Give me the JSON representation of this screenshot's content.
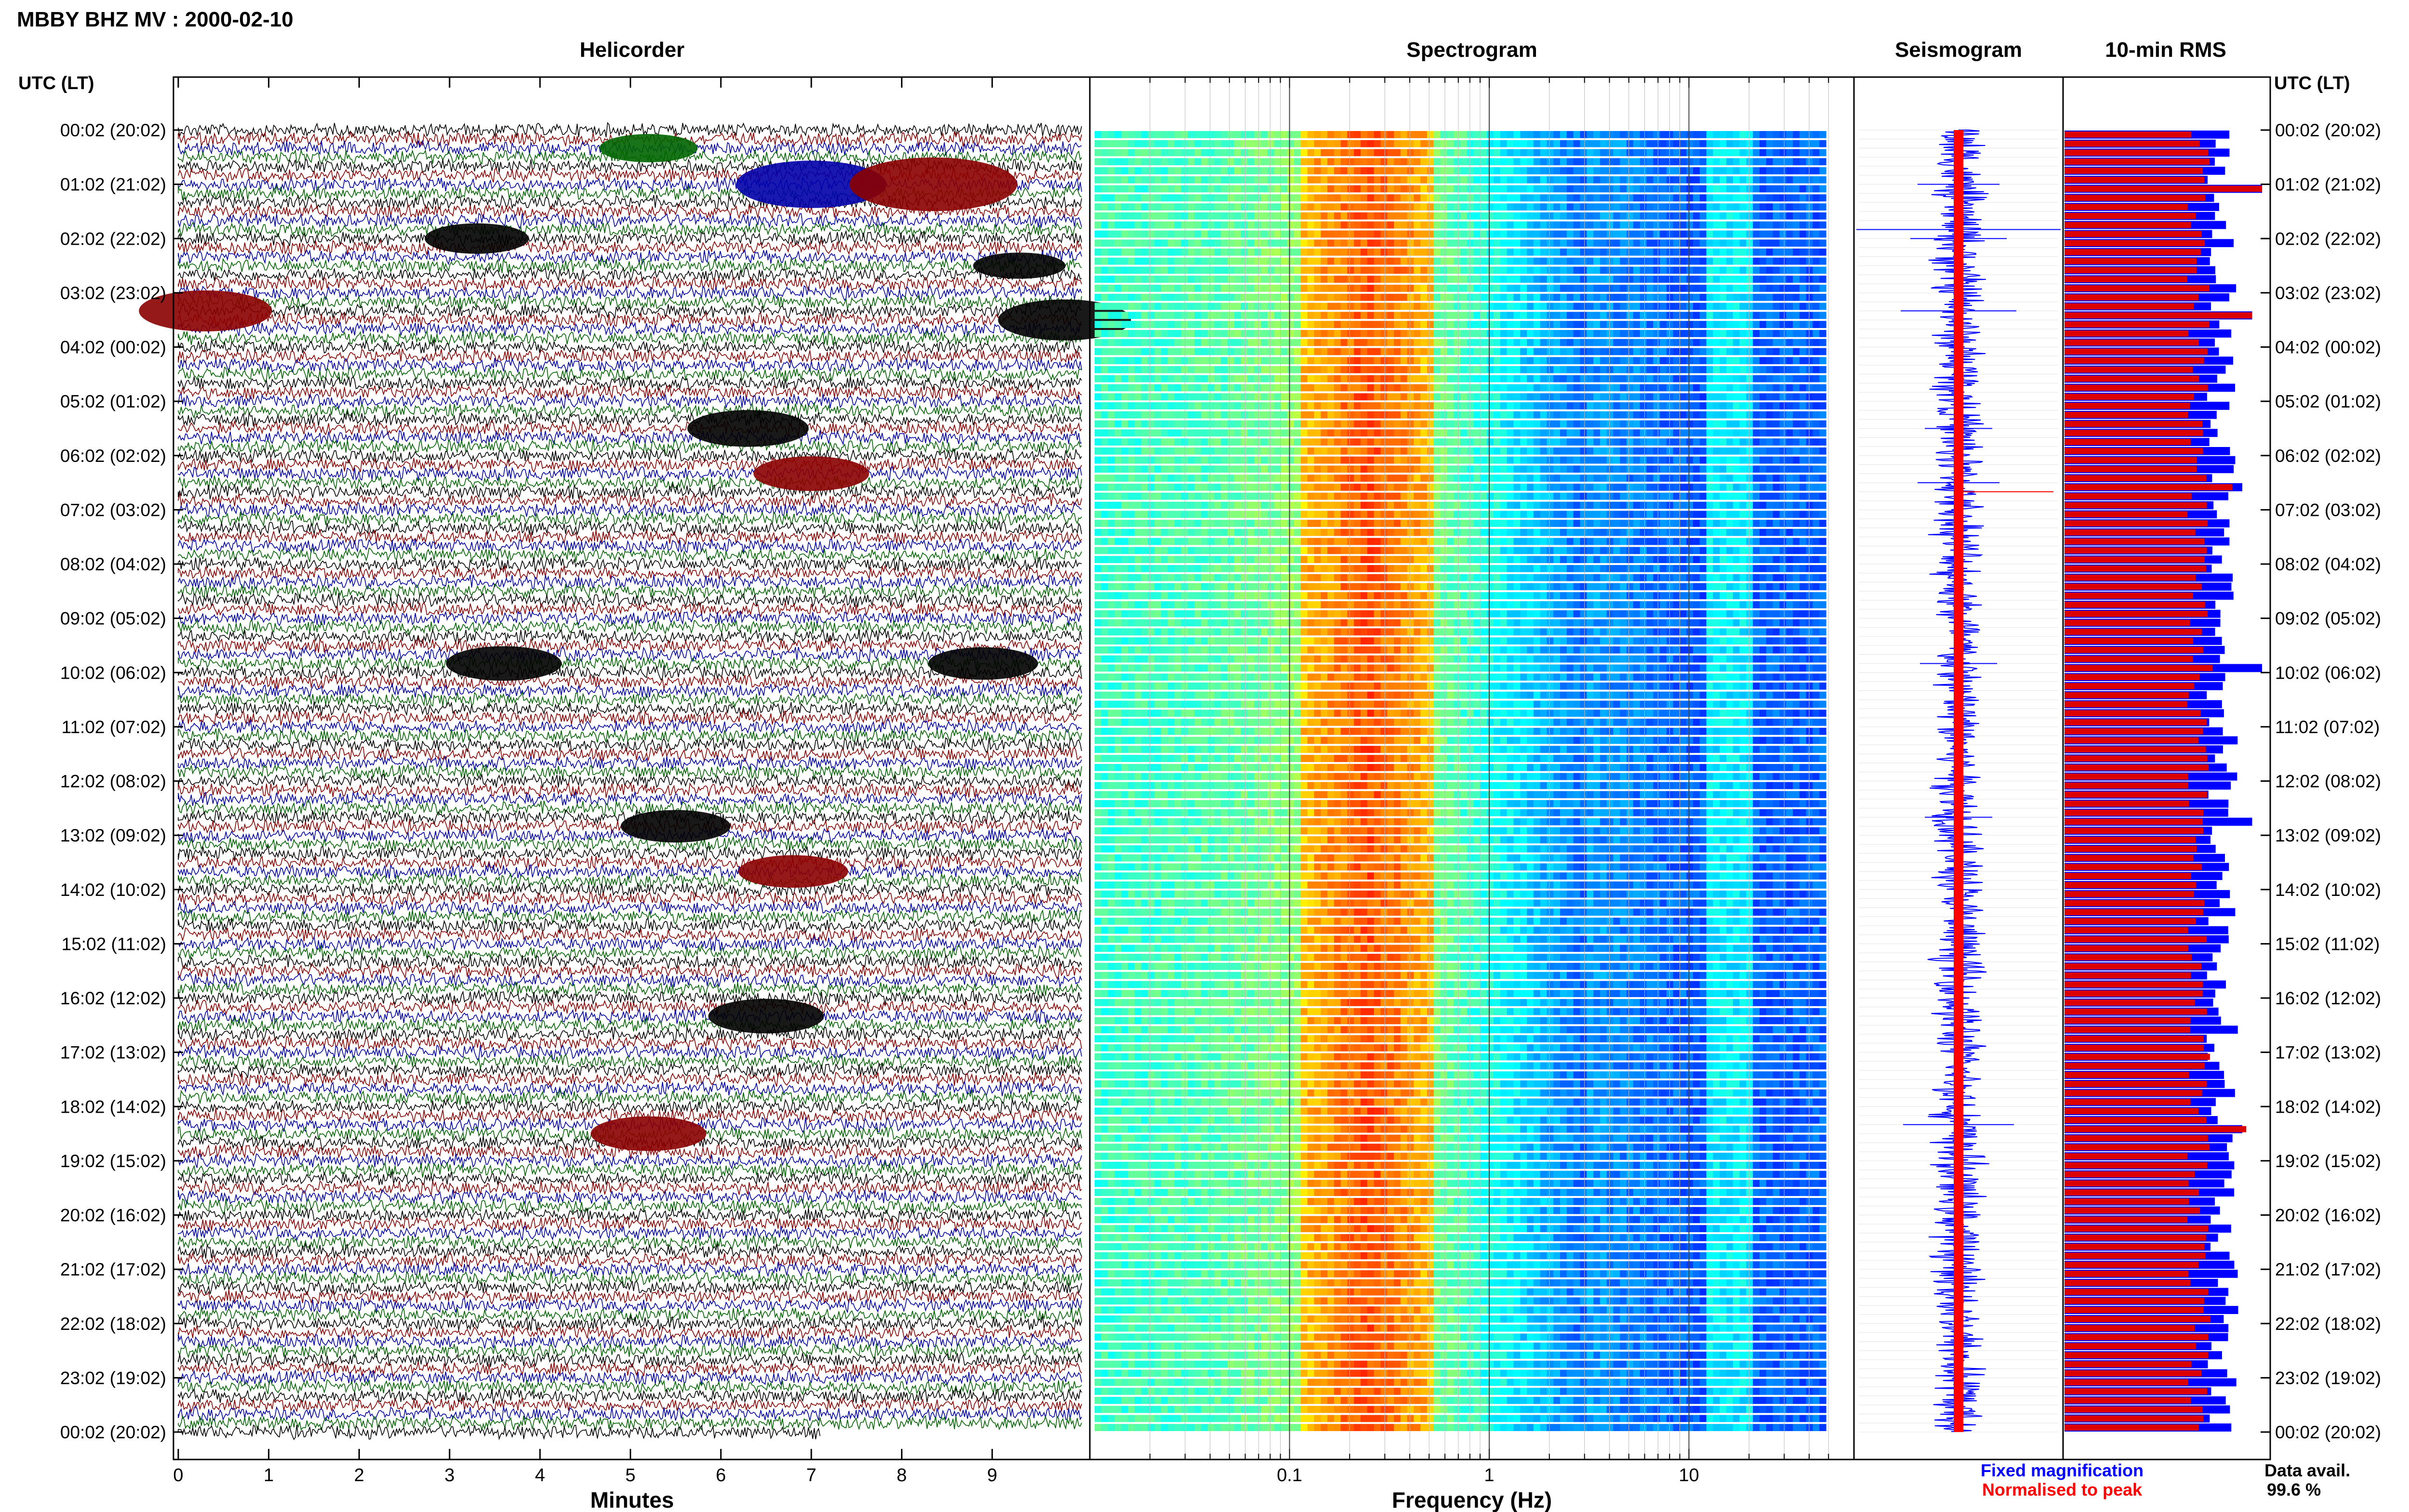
{
  "title": "MBBY BHZ MV : 2000-02-10",
  "panels": {
    "helicorder": "Helicorder",
    "spectrogram": "Spectrogram",
    "seismogram": "Seismogram",
    "rms": "10-min RMS"
  },
  "utc_label": "UTC (LT)",
  "time_labels": [
    "00:02 (20:02)",
    "01:02 (21:02)",
    "02:02 (22:02)",
    "03:02 (23:02)",
    "04:02 (00:02)",
    "05:02 (01:02)",
    "06:02 (02:02)",
    "07:02 (03:02)",
    "08:02 (04:02)",
    "09:02 (05:02)",
    "10:02 (06:02)",
    "11:02 (07:02)",
    "12:02 (08:02)",
    "13:02 (09:02)",
    "14:02 (10:02)",
    "15:02 (11:02)",
    "16:02 (12:02)",
    "17:02 (13:02)",
    "18:02 (14:02)",
    "19:02 (15:02)",
    "20:02 (16:02)",
    "21:02 (17:02)",
    "22:02 (18:02)",
    "23:02 (19:02)",
    "00:02 (20:02)"
  ],
  "x_axes": {
    "minutes": {
      "label": "Minutes",
      "ticks": [
        "0",
        "1",
        "2",
        "3",
        "4",
        "5",
        "6",
        "7",
        "8",
        "9"
      ]
    },
    "frequency": {
      "label": "Frequency (Hz)",
      "ticks": [
        "0.1",
        "1",
        "10"
      ],
      "scale": "log",
      "range_hz": [
        0.01,
        60
      ]
    }
  },
  "legend": {
    "fixed": {
      "text": "Fixed magnification",
      "color": "#0000ff"
    },
    "normalised": {
      "text": "Normalised to peak",
      "color": "#ff0000"
    }
  },
  "data_availability": {
    "label": "Data avail.",
    "value": "99.6 %"
  },
  "colors": {
    "trace_cycle": [
      "#000000",
      "#8b0000",
      "#0000aa",
      "#006400"
    ],
    "rms_fixed": "#0000ff",
    "rms_normalised": "#dd0000"
  },
  "chart_data": {
    "type": "heatmap",
    "rows_per_hour": 6,
    "hours": 24,
    "helicorder_events": [
      {
        "row": 2,
        "minute": 5.2,
        "amp": 0.7,
        "color_index": 3
      },
      {
        "row": 6,
        "minute": 7.0,
        "amp": 1.6,
        "color_index": 2
      },
      {
        "row": 6,
        "minute": 8.35,
        "amp": 1.9,
        "color_index": 1
      },
      {
        "row": 12,
        "minute": 3.3,
        "amp": 0.8,
        "color_index": 0
      },
      {
        "row": 15,
        "minute": 9.3,
        "amp": 0.6,
        "color_index": 0
      },
      {
        "row": 20,
        "minute": 0.3,
        "amp": 1.3,
        "color_index": 1
      },
      {
        "row": 21,
        "minute": 9.8,
        "amp": 1.3,
        "color_index": 0
      },
      {
        "row": 33,
        "minute": 6.3,
        "amp": 1.1,
        "color_index": 0
      },
      {
        "row": 38,
        "minute": 7.0,
        "amp": 1.0,
        "color_index": 1
      },
      {
        "row": 59,
        "minute": 3.6,
        "amp": 1.0,
        "color_index": 0
      },
      {
        "row": 59,
        "minute": 8.9,
        "amp": 0.9,
        "color_index": 0
      },
      {
        "row": 77,
        "minute": 5.5,
        "amp": 0.9,
        "color_index": 0
      },
      {
        "row": 82,
        "minute": 6.8,
        "amp": 0.9,
        "color_index": 1
      },
      {
        "row": 98,
        "minute": 6.5,
        "amp": 1.0,
        "color_index": 0
      },
      {
        "row": 111,
        "minute": 5.2,
        "amp": 1.0,
        "color_index": 1
      }
    ],
    "rms_spikes": [
      {
        "row": 6,
        "fixed": 1.0,
        "normalised": 1.0
      },
      {
        "row": 20,
        "fixed": 0.95,
        "normalised": 0.95
      },
      {
        "row": 39,
        "fixed": 0.9,
        "normalised": 0.85
      },
      {
        "row": 59,
        "fixed": 1.0,
        "normalised": 0.75
      },
      {
        "row": 76,
        "fixed": 0.95,
        "normalised": 0.7
      },
      {
        "row": 110,
        "fixed": 0.9,
        "normalised": 0.92
      }
    ]
  }
}
